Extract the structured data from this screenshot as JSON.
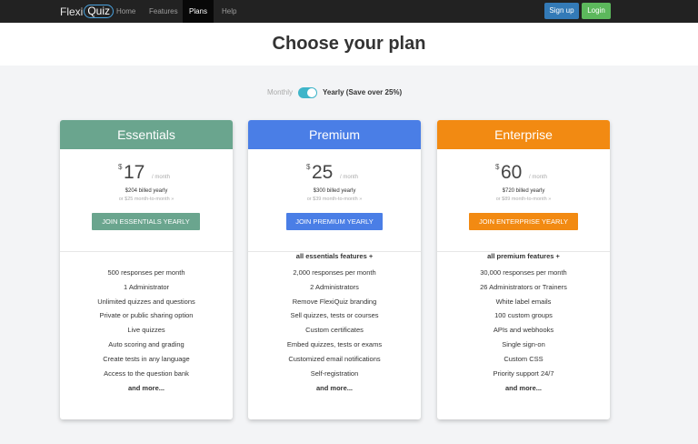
{
  "nav": {
    "logo_flexi": "Flexi",
    "logo_quiz": "Quiz",
    "items": [
      {
        "label": "Home"
      },
      {
        "label": "Features"
      },
      {
        "label": "Plans",
        "active": true
      },
      {
        "label": "Help"
      }
    ],
    "signup_label": "Sign up",
    "login_label": "Login"
  },
  "page": {
    "title": "Choose your plan"
  },
  "billing_toggle": {
    "monthly_label": "Monthly",
    "yearly_label": "Yearly (Save over 25%)",
    "selected": "yearly"
  },
  "plans": [
    {
      "name": "Essentials",
      "currency": "$",
      "price": "17",
      "per": "/ month",
      "billed": "$204 billed yearly",
      "alt": "or $25 month-to-month »",
      "button": "JOIN ESSENTIALS YEARLY",
      "section_label": "",
      "features": [
        "500 responses per month",
        "1 Administrator",
        "Unlimited quizzes and questions",
        "Private or public sharing option",
        "Live quizzes",
        "Auto scoring and grading",
        "Create tests in any language",
        "Access to the question bank"
      ],
      "more": "and more...",
      "color": "#6aa58e"
    },
    {
      "name": "Premium",
      "currency": "$",
      "price": "25",
      "per": "/ month",
      "billed": "$300 billed yearly",
      "alt": "or $39 month-to-month »",
      "button": "JOIN PREMIUM YEARLY",
      "section_label": "all essentials features +",
      "features": [
        "2,000 responses per month",
        "2 Administrators",
        "Remove FlexiQuiz branding",
        "Sell quizzes, tests or courses",
        "Custom certificates",
        "Embed quizzes, tests or exams",
        "Customized email notifications",
        "Self-registration"
      ],
      "more": "and more...",
      "color": "#4a7ee6"
    },
    {
      "name": "Enterprise",
      "currency": "$",
      "price": "60",
      "per": "/ month",
      "billed": "$720 billed yearly",
      "alt": "or $89 month-to-month »",
      "button": "JOIN ENTERPRISE YEARLY",
      "section_label": "all premium features +",
      "features": [
        "30,000 responses per month",
        "26 Administrators or Trainers",
        "White label emails",
        "100 custom groups",
        "APIs and webhooks",
        "Single sign-on",
        "Custom CSS",
        "Priority support 24/7"
      ],
      "more": "and more...",
      "color": "#f28a12"
    }
  ]
}
